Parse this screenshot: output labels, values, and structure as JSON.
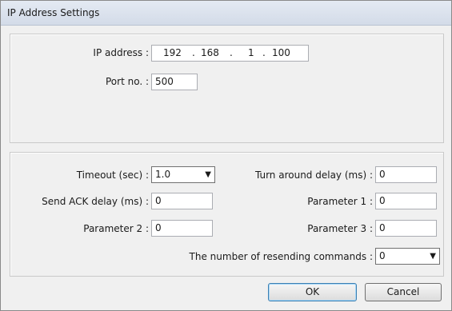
{
  "window": {
    "title": "IP Address Settings"
  },
  "network": {
    "ip_label": "IP address :",
    "ip_octets": [
      "192",
      "168",
      "1",
      "100"
    ],
    "port_label": "Port no. :",
    "port_value": "500"
  },
  "comm": {
    "timeout_label": "Timeout (sec) :",
    "timeout_value": "1.0",
    "turnaround_label": "Turn around delay (ms) :",
    "turnaround_value": "0",
    "send_ack_label": "Send ACK delay (ms) :",
    "send_ack_value": "0",
    "param1_label": "Parameter 1 :",
    "param1_value": "0",
    "param2_label": "Parameter 2 :",
    "param2_value": "0",
    "param3_label": "Parameter 3 :",
    "param3_value": "0",
    "resend_label": "The number of resending commands :",
    "resend_value": "0"
  },
  "buttons": {
    "ok": "OK",
    "cancel": "Cancel"
  },
  "icons": {
    "dropdown": "chevron-down-icon"
  }
}
